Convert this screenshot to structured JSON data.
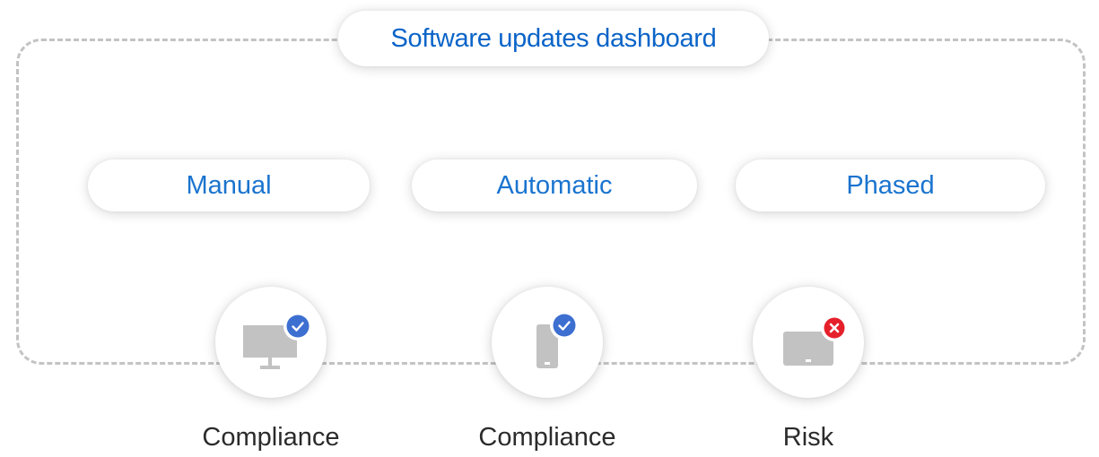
{
  "title": "Software updates dashboard",
  "strategies": [
    {
      "label": "Manual"
    },
    {
      "label": "Automatic"
    },
    {
      "label": "Phased"
    }
  ],
  "devices": [
    {
      "icon": "desktop-monitor-icon",
      "badge": "check-badge-icon",
      "label": "Compliance"
    },
    {
      "icon": "mobile-phone-icon",
      "badge": "check-badge-icon",
      "label": "Compliance"
    },
    {
      "icon": "tablet-icon",
      "badge": "error-badge-icon",
      "label": "Risk"
    }
  ],
  "colors": {
    "title_text": "#0a64c8",
    "pill_text": "#1a74cf",
    "frame_dash": "#c3c3c3",
    "device_gray": "#c2c2c2",
    "check_badge": "#3d6fd1",
    "error_badge": "#e5202b"
  }
}
